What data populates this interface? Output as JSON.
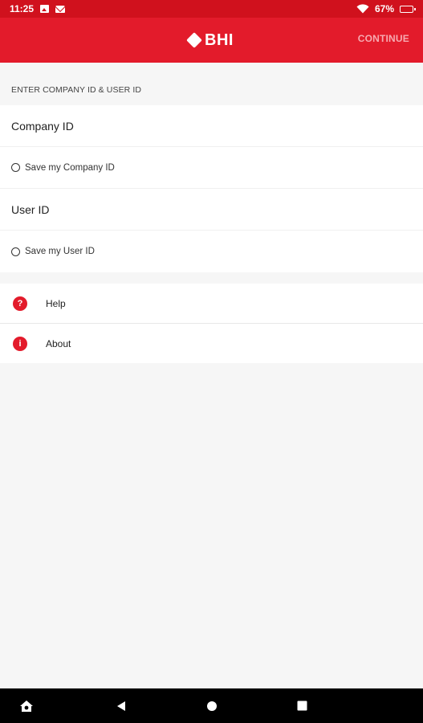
{
  "status_bar": {
    "time": "11:25",
    "battery": "67%",
    "icons": [
      "image-icon",
      "mail-icon",
      "wifi-icon",
      "battery-icon"
    ]
  },
  "app_bar": {
    "logo_text": "BHI",
    "continue_label": "CONTINUE"
  },
  "form": {
    "section_title": "ENTER COMPANY ID & USER ID",
    "company_id_placeholder": "Company ID",
    "save_company_label": "Save my Company ID",
    "user_id_placeholder": "User ID",
    "save_user_label": "Save my User ID"
  },
  "menu": {
    "items": [
      {
        "label": "Help",
        "icon": "help-icon",
        "glyph": "?"
      },
      {
        "label": "About",
        "icon": "info-icon",
        "glyph": "i"
      }
    ]
  },
  "nav_bar": {
    "icons": [
      "home-assistant-icon",
      "back-icon",
      "home-icon",
      "recents-icon"
    ]
  },
  "colors": {
    "brand_red": "#e31b2b",
    "status_red": "#d0111d",
    "background": "#f6f6f6"
  }
}
